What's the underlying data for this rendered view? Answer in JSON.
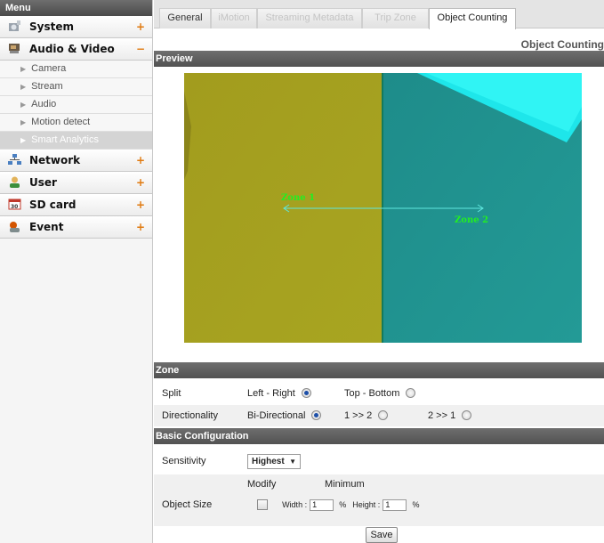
{
  "menu": {
    "title": "Menu",
    "categories": [
      {
        "label": "System",
        "sign": "+",
        "icon": "gear-icon"
      },
      {
        "label": "Audio & Video",
        "sign": "−",
        "icon": "camera-icon"
      },
      {
        "label": "Network",
        "sign": "+",
        "icon": "network-icon"
      },
      {
        "label": "User",
        "sign": "+",
        "icon": "user-icon"
      },
      {
        "label": "SD card",
        "sign": "+",
        "icon": "sd-card-icon"
      },
      {
        "label": "Event",
        "sign": "+",
        "icon": "event-icon"
      }
    ],
    "av_items": [
      "Camera",
      "Stream",
      "Audio",
      "Motion detect",
      "Smart Analytics"
    ],
    "arrow": "▶"
  },
  "tabs": [
    "General",
    "iMotion",
    "Streaming Metadata",
    "Trip Zone",
    "Object Counting"
  ],
  "page_title": "Object Counting",
  "preview": {
    "header": "Preview",
    "zone1_label": "Zone 1",
    "zone2_label": "Zone 2"
  },
  "zone": {
    "header": "Zone",
    "split_label": "Split",
    "split_options": [
      "Left - Right",
      "Top - Bottom"
    ],
    "direction_label": "Directionality",
    "direction_options": [
      "Bi-Directional",
      "1 >> 2",
      "2 >> 1"
    ]
  },
  "basic": {
    "header": "Basic Configuration",
    "sensitivity_label": "Sensitivity",
    "sensitivity_value": "Highest",
    "modify_label": "Modify",
    "minimum_label": "Minimum",
    "object_size_label": "Object Size",
    "width_label": "Width :",
    "width_value": "1",
    "height_label": "Height :",
    "height_value": "1",
    "percent": "%"
  },
  "save_label": "Save",
  "colors": {
    "accent_sign": "#e07a10",
    "left_zone": "#a39e1e",
    "right_zone": "#1f9090",
    "zone_label": "#22ee22",
    "line": "#5fe7df"
  }
}
